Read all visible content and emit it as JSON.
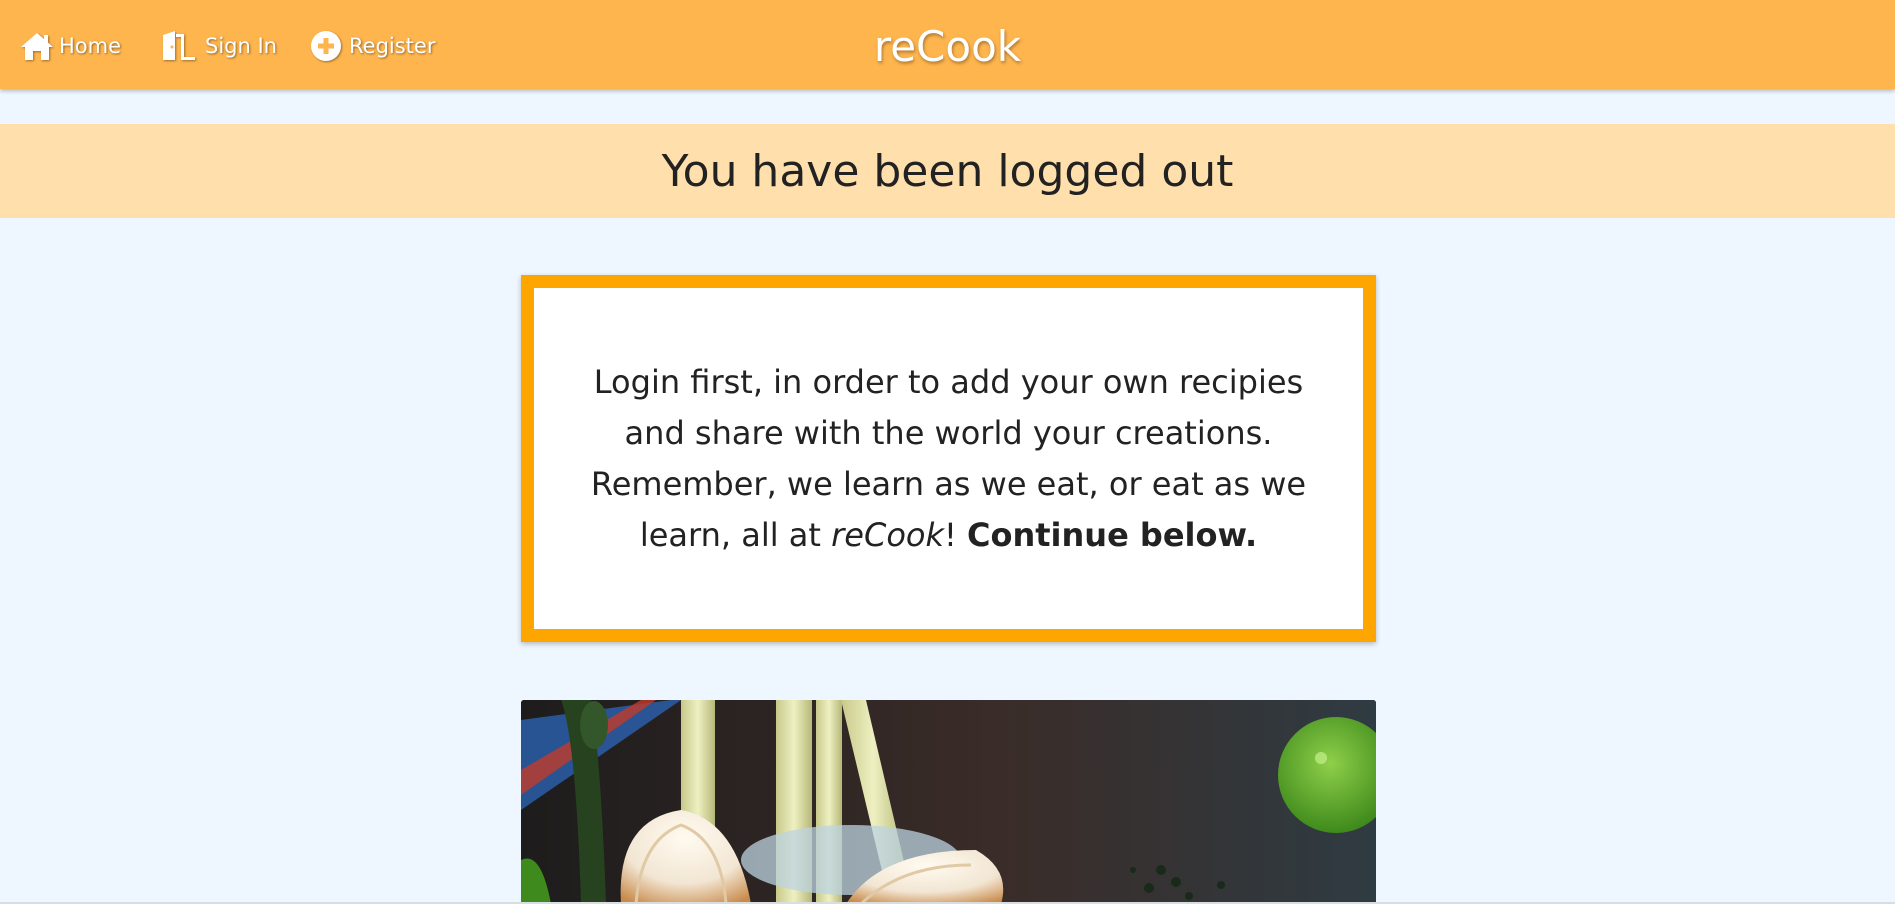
{
  "nav": {
    "home_label": "Home",
    "signin_label": "Sign In",
    "register_label": "Register",
    "brand": "reCook",
    "icons": {
      "home": "home-icon",
      "signin": "door-icon",
      "register": "plus-circle-icon"
    }
  },
  "banner": {
    "message": "You have been logged out"
  },
  "info": {
    "text_lead": "Login first, in order to add your own recipies and share with the world your creations. Remember, we learn as we eat, or eat as we learn, all at ",
    "brand_italic": "reCook",
    "exclaim": "! ",
    "continue_bold": "Continue below."
  },
  "colors": {
    "navbar": "#ffb54d",
    "banner": "#ffdfab",
    "page_bg": "#eef6ff",
    "box_border": "#ffa500"
  }
}
